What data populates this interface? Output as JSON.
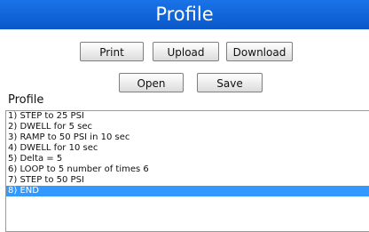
{
  "header": {
    "title": "Profile"
  },
  "toolbar": {
    "print_label": "Print",
    "upload_label": "Upload",
    "download_label": "Download",
    "open_label": "Open",
    "save_label": "Save"
  },
  "profile": {
    "label": "Profile",
    "steps": [
      "1) STEP to 25 PSI",
      "2) DWELL for 5 sec",
      "3) RAMP to 50 PSI in 10 sec",
      "4) DWELL for 10 sec",
      "5) Delta = 5",
      "6) LOOP to 5 number of times 6",
      "7) STEP to 50 PSI",
      "8) END"
    ],
    "selected_index": 7
  },
  "colors": {
    "title_bar": "#0a58ca",
    "selection": "#3399ff"
  }
}
